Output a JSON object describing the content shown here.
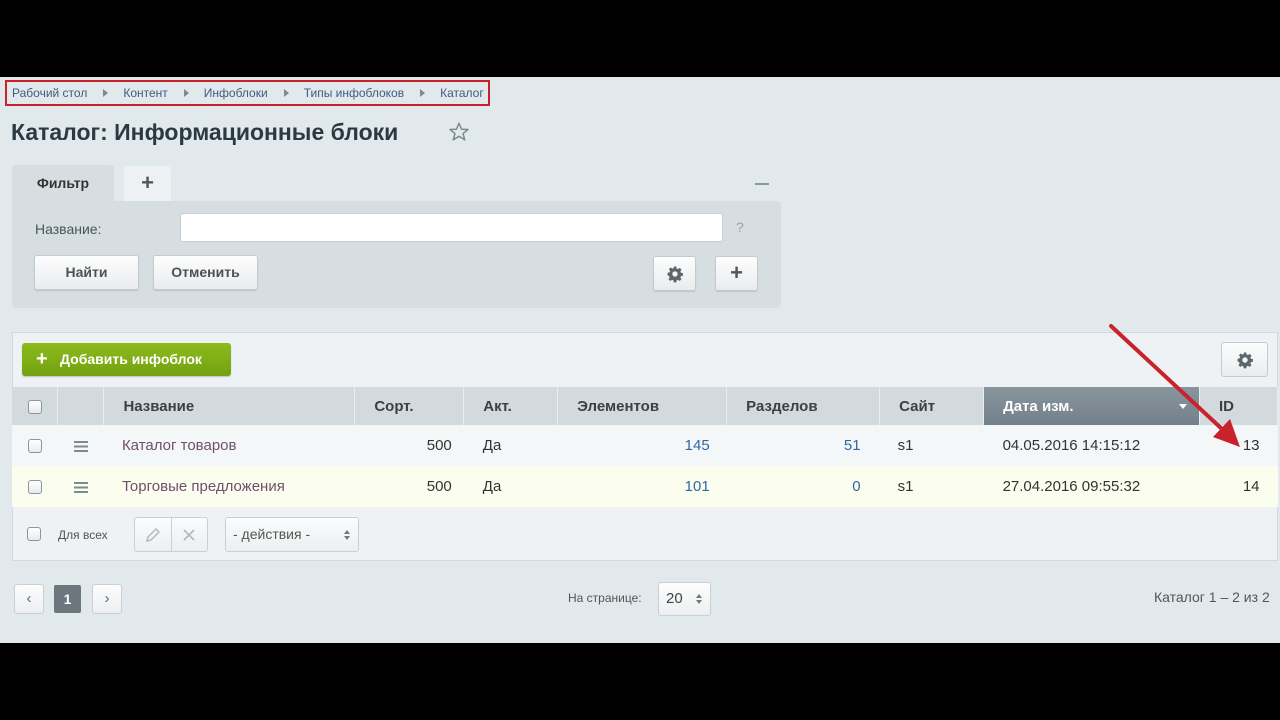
{
  "breadcrumb": [
    "Рабочий стол",
    "Контент",
    "Инфоблоки",
    "Типы инфоблоков",
    "Каталог"
  ],
  "page_title": "Каталог: Информационные блоки",
  "filter": {
    "tab_label": "Фильтр",
    "add_tab_label": "+",
    "name_label": "Название:",
    "name_value": "",
    "help": "?",
    "find_label": "Найти",
    "cancel_label": "Отменить",
    "plus_label": "+"
  },
  "toolbar": {
    "add_iblock_label": "Добавить инфоблок",
    "add_icon": "+"
  },
  "table": {
    "columns": [
      "Название",
      "Сорт.",
      "Акт.",
      "Элементов",
      "Разделов",
      "Сайт",
      "Дата изм.",
      "ID"
    ],
    "sorted_column": "Дата изм.",
    "rows": [
      {
        "name": "Каталог товаров",
        "sort": "500",
        "active": "Да",
        "elements": "145",
        "sections": "51",
        "site": "s1",
        "date": "04.05.2016 14:15:12",
        "id": "13"
      },
      {
        "name": "Торговые предложения",
        "sort": "500",
        "active": "Да",
        "elements": "101",
        "sections": "0",
        "site": "s1",
        "date": "27.04.2016 09:55:32",
        "id": "14"
      }
    ]
  },
  "footer": {
    "for_all_label": "Для всех",
    "actions_value": "- действия -"
  },
  "pagination": {
    "prev": "‹",
    "current_page": "1",
    "next": "›",
    "per_page_label": "На странице:",
    "per_page_value": "20",
    "count_text": "Каталог 1 – 2 из 2"
  },
  "colors": {
    "accent_green": "#7fb01a",
    "annotation_red": "#c8232c",
    "link_purple": "#70506a",
    "link_blue": "#2f68a5"
  }
}
